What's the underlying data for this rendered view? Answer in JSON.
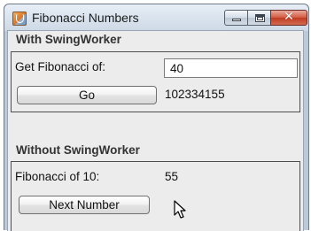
{
  "window": {
    "title": "Fibonacci Numbers",
    "controls": [
      "minimize",
      "maximize",
      "close"
    ]
  },
  "with_swingworker": {
    "group_title": "With SwingWorker",
    "input_label": "Get Fibonacci of:",
    "input_value": "40",
    "button_label": "Go",
    "result": "102334155"
  },
  "without_swingworker": {
    "group_title": "Without SwingWorker",
    "result_label": "Fibonacci of 10:",
    "result_value": "55",
    "button_label": "Next Number"
  },
  "icons": {
    "app": "java-cup-icon",
    "minimize": "minimize-icon",
    "maximize": "maximize-icon",
    "close": "close-icon",
    "pointer": "mouse-pointer-icon"
  }
}
